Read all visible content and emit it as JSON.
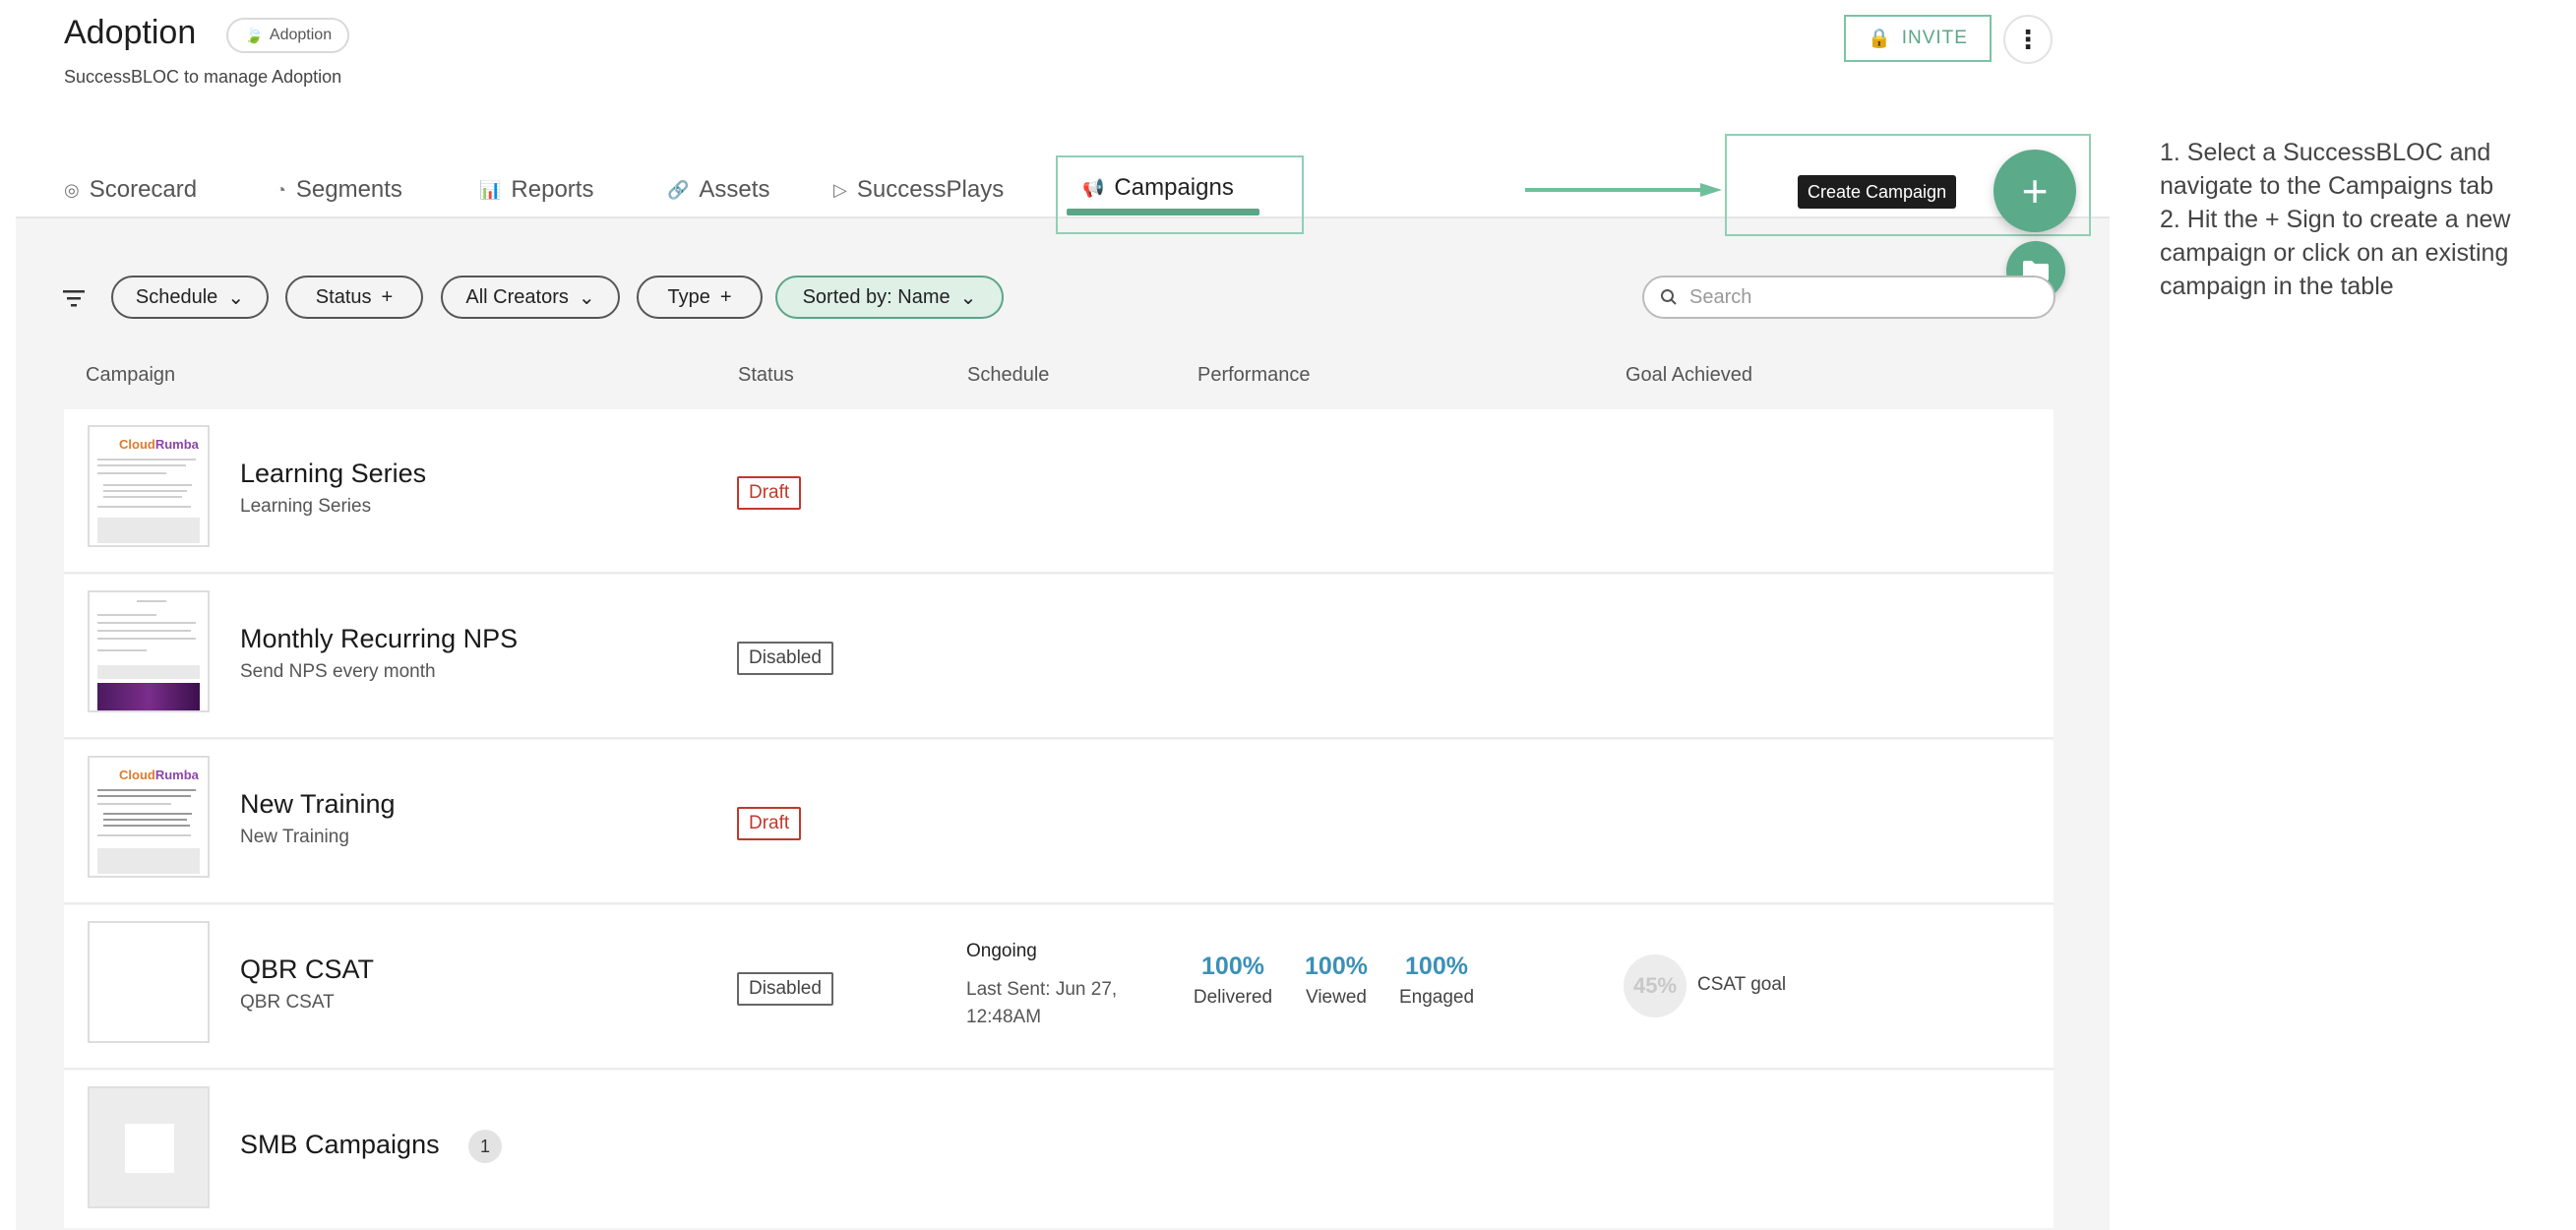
{
  "header": {
    "title": "Adoption",
    "badge": "Adoption",
    "subtitle": "SuccessBLOC to manage Adoption",
    "invite_label": "INVITE",
    "more_label": "⋮"
  },
  "tabs": [
    {
      "label": "Scorecard",
      "icon": "◎"
    },
    {
      "label": "Segments",
      "icon": "◔"
    },
    {
      "label": "Reports",
      "icon": "📊"
    },
    {
      "label": "Assets",
      "icon": "🔗"
    },
    {
      "label": "SuccessPlays",
      "icon": "▷"
    },
    {
      "label": "Campaigns",
      "icon": "📢"
    }
  ],
  "fab": {
    "tooltip": "Create Campaign",
    "plus": "+"
  },
  "filters": {
    "chips": [
      {
        "label": "Schedule",
        "suffix": "⌄"
      },
      {
        "label": "Status",
        "suffix": "+"
      },
      {
        "label": "All Creators",
        "suffix": "⌄"
      },
      {
        "label": "Type",
        "suffix": "+"
      },
      {
        "label": "Sorted by: Name",
        "suffix": "⌄"
      }
    ],
    "search_placeholder": "Search"
  },
  "columns": [
    "Campaign",
    "Status",
    "Schedule",
    "Performance",
    "Goal Achieved"
  ],
  "rows": [
    {
      "name": "Learning Series",
      "sub": "Learning Series",
      "status": "Draft"
    },
    {
      "name": "Monthly Recurring NPS",
      "sub": "Send NPS every month",
      "status": "Disabled"
    },
    {
      "name": "New Training",
      "sub": "New Training",
      "status": "Draft"
    },
    {
      "name": "QBR CSAT",
      "sub": "QBR CSAT",
      "status": "Disabled",
      "schedule_main": "Ongoing",
      "schedule_sub": "Last Sent: Jun 27, 12:48AM",
      "perf": [
        {
          "value": "100%",
          "label": "Delivered"
        },
        {
          "value": "100%",
          "label": "Viewed"
        },
        {
          "value": "100%",
          "label": "Engaged"
        }
      ],
      "goal_value": "45%",
      "goal_label": "CSAT goal"
    },
    {
      "name": "SMB Campaigns",
      "count": "1"
    }
  ],
  "thumb_logo": {
    "part1": "Cloud",
    "part2": "Rumba"
  },
  "instructions": {
    "line1": "1. Select a SuccessBLOC and navigate to the Campaigns tab",
    "line2": "2. Hit the + Sign to create a new campaign or click on an existing campaign in the table"
  },
  "colors": {
    "accent": "#5bab8b",
    "draft": "#c0392b",
    "performance": "#3a90b8"
  }
}
